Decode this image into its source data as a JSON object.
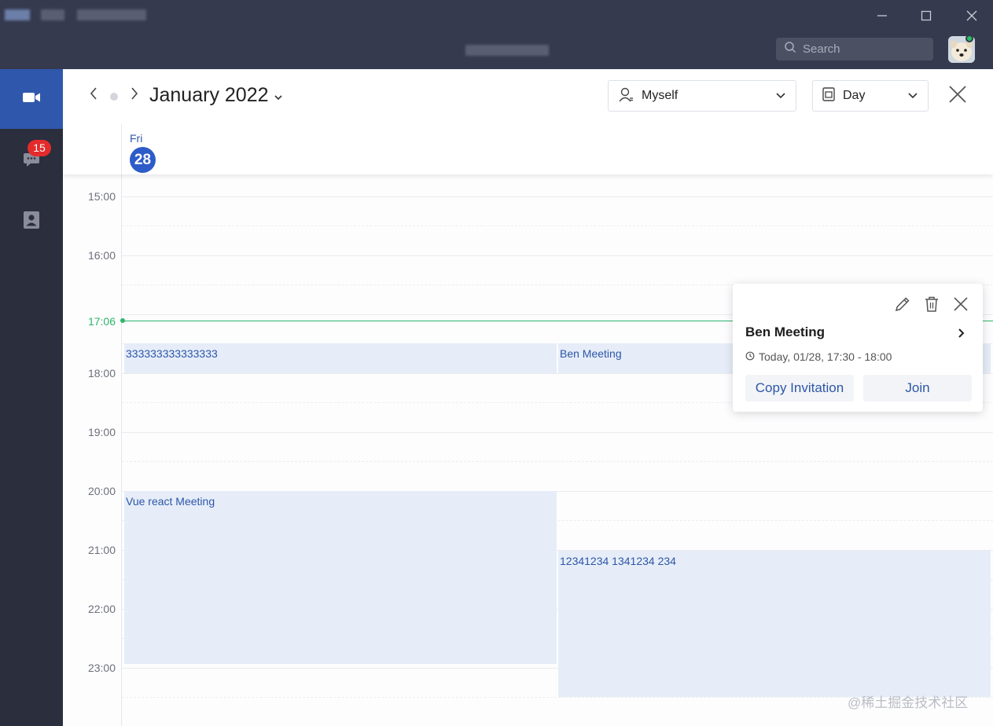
{
  "window": {
    "minimize_icon": "minimize-icon",
    "maximize_icon": "maximize-icon",
    "close_icon": "close-icon"
  },
  "header": {
    "search_placeholder": "Search"
  },
  "sidebar": {
    "items": [
      {
        "icon": "video-camera-icon",
        "active": true
      },
      {
        "icon": "chat-icon",
        "badge": "15"
      },
      {
        "icon": "contacts-icon"
      }
    ]
  },
  "toolbar": {
    "month_label": "January 2022",
    "person_select": "Myself",
    "view_select": "Day"
  },
  "day_header": {
    "weekday": "Fri",
    "day_number": "28"
  },
  "time_labels": [
    "15:00",
    "16:00",
    "17:06",
    "18:00",
    "19:00",
    "20:00",
    "21:00",
    "22:00",
    "23:00"
  ],
  "current_time": "17:06",
  "events": [
    {
      "title": "333333333333333",
      "start": "17:30",
      "end": "18:00",
      "column": 1
    },
    {
      "title": "Ben Meeting",
      "start": "17:30",
      "end": "18:00",
      "column": 2
    },
    {
      "title": "Vue react Meeting",
      "start": "20:00",
      "end": "23:00",
      "column": 1
    },
    {
      "title": "12341234 1341234 234",
      "start": "21:00",
      "end": "23:30",
      "column": 2
    }
  ],
  "popup": {
    "title": "Ben Meeting",
    "time": "Today, 01/28, 17:30 - 18:00",
    "copy_label": "Copy Invitation",
    "join_label": "Join"
  },
  "colors": {
    "titlebar": "#363a4f",
    "sidebar": "#2b2e3d",
    "accent": "#2f58ad",
    "event_bg": "#e6edf8",
    "now_line": "#2fb46a",
    "badge": "#e32b2b"
  },
  "watermark": "@稀土掘金技术社区"
}
